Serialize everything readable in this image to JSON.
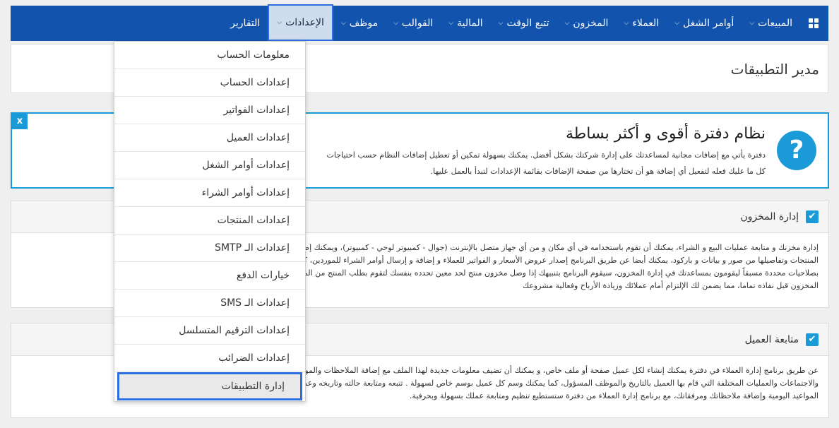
{
  "nav": {
    "items": [
      {
        "label": "المبيعات",
        "has_dropdown": true
      },
      {
        "label": "أوامر الشغل",
        "has_dropdown": true
      },
      {
        "label": "العملاء",
        "has_dropdown": true
      },
      {
        "label": "المخزون",
        "has_dropdown": true
      },
      {
        "label": "تتبع الوقت",
        "has_dropdown": true
      },
      {
        "label": "المالية",
        "has_dropdown": true
      },
      {
        "label": "القوالب",
        "has_dropdown": true
      },
      {
        "label": "موظف",
        "has_dropdown": true
      },
      {
        "label": "الإعدادات",
        "has_dropdown": true,
        "active": true
      },
      {
        "label": "التقارير",
        "has_dropdown": false
      }
    ],
    "menu_icon": "grid-icon",
    "chevron_icon": "chevron-down-icon",
    "colors": {
      "bar": "#1254ad",
      "active_bg": "#cfdcee",
      "active_border": "#2d6fe0"
    }
  },
  "dropdown": {
    "items": [
      "معلومات الحساب",
      "إعدادات الحساب",
      "إعدادات الفواتير",
      "إعدادات العميل",
      "إعدادات أوامر الشغل",
      "إعدادات أوامر الشراء",
      "إعدادات المنتجات",
      "إعدادات الـ SMTP",
      "خيارات الدفع",
      "إعدادات الـ SMS",
      "إعدادات الترقيم المتسلسل",
      "إعدادات الضرائب",
      "إدارة التطبيقات"
    ],
    "active_index": 12
  },
  "page": {
    "title": "مدير التطبيقات"
  },
  "info_box": {
    "close_label": "x",
    "icon": "question-icon",
    "icon_glyph": "?",
    "heading": "نظام دفترة أقوى و أكثر بساطة",
    "line1": "دفترة يأتي مع إضافات مجانية لمساعدتك على إدارة شركتك بشكل أفضل. يمكنك بسهولة تمكين أو تعطيل إضافات النظام حسب احتياجات",
    "line2": "كل ما عليك فعله لتفعيل أي إضافة هو أن تختارها من صفحة الإضافات بقائمة الإعدادات لتبدأ بالعمل عليها.",
    "accent": "#1a9ad6"
  },
  "sections": [
    {
      "title": "إدارة المخزون",
      "checked": true,
      "lines": [
        "إدارة مخزنك و متابعة عمليات البيع و الشراء، يمكنك أن تقوم باستخدامه في أي مكان و من أي جهاز متصل بالإنترنت (جوال - كمبيوتر لوحي - كمبيوتر)، ويمكنك إضافة عدد غير محدود من",
        "المنتجات وتفاصيلها من صور و بيانات و باركود، يمكنك أيضا عن طريق البرنامج إصدار عروض الأسعار و الفواتير للعملاء و إضافة و إرسال أوامر الشراء للموردين، كما يمكنك إضافة موظفين",
        "بصلاحيات محددة مسبقاً ليقومون بمساعدتك في إدارة المخزون، سيقوم البرنامج بتنبيهك إذا وصل مخزون منتج لحد معين تحدده بنفسك لتقوم بطلب المنتج من المورد بسرعة لزيادة",
        "المخزون قبل نفاذه تماما، مما يضمن لك الإلتزام أمام عملائك وزيادة الأرباح وفعالية مشروعك"
      ]
    },
    {
      "title": "متابعة العميل",
      "checked": true,
      "lines": [
        "عن طريق برنامج إدارة العملاء في دفترة يمكنك إنشاء لكل عميل صفحة أو ملف خاص، و يمكنك أن تضيف معلومات جديدة لهذا الملف مع إضافة الملاحظات والمواعيد والملفات المرفقة",
        "والاجتماعات والعمليات المختلفة التي قام بها العميل بالتاريخ والموظف المسؤول، كما يمكنك وسم كل عميل بوسم خاص لسهولة . تتبعه ومتابعة حالته وتاريخه وعمليات كل عميل، ومشاهدة",
        "المواعيد اليومية وإضافة ملاحظاتك ومرفقاتك، مع برنامج إدارة العملاء من دفترة ستستطيع تنظيم ومتابعة عملك بسهولة وبحرفية."
      ]
    }
  ]
}
